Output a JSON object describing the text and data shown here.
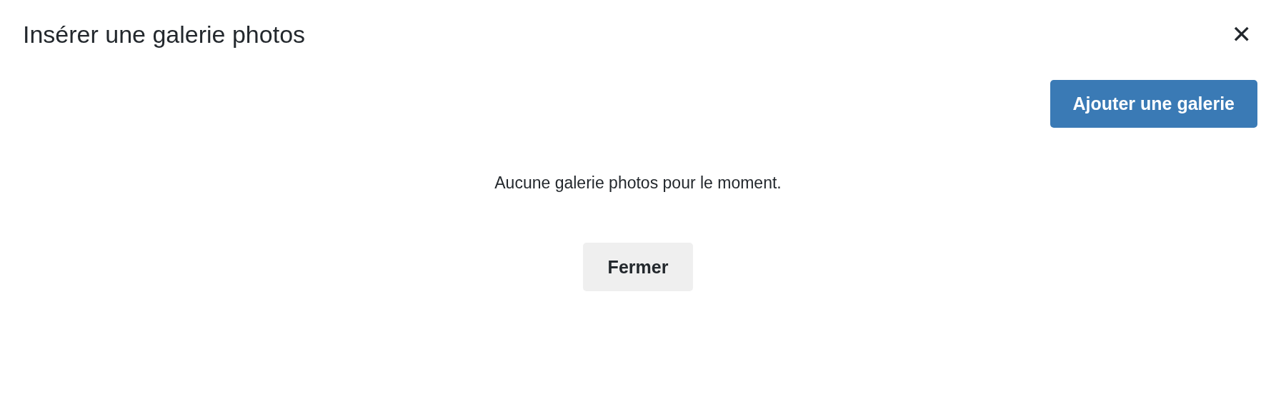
{
  "dialog": {
    "title": "Insérer une galerie photos",
    "close": "✕"
  },
  "actions": [
    {
      "label": "Ajouter une galerie",
      "kind": "primary"
    }
  ],
  "message": "Aucune galerie photos pour le moment.",
  "buttons": [
    {
      "label": "Fermer",
      "kind": "secondary"
    }
  ]
}
